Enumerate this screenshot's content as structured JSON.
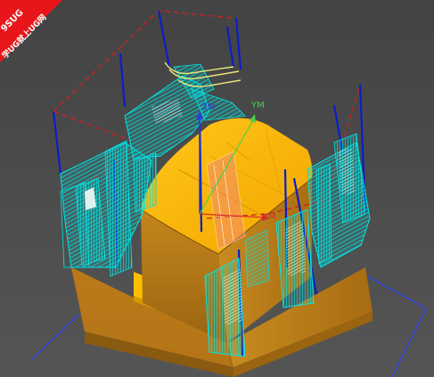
{
  "viewport": {
    "background": "#4a4a4a"
  },
  "watermark": {
    "line1": "9SUG",
    "line2": "学UG就上UG网",
    "color": "#e8161b"
  },
  "axes": {
    "ym_label": "YM",
    "zm_label": "ZM",
    "xm_label": "XM",
    "ym_color": "#49d049",
    "zm_color": "#2b3fd8",
    "xm_color": "#d82b2b"
  },
  "colors": {
    "part_top": "#f5b400",
    "part_side_front": "#b97a14",
    "part_side_right": "#c2861c",
    "base_front": "#b87819",
    "base_right": "#c98a1e",
    "toolpath_cut": "#00e1e1",
    "toolpath_engage": "#ffffff",
    "toolpath_plunge": "#0a1ec8",
    "toolpath_rapid": "#d22020",
    "toolpath_selected": "#e8e87a",
    "bounding_box": "#2a40ff"
  },
  "icons": {
    "wcs": "coordinate-axes-icon"
  }
}
